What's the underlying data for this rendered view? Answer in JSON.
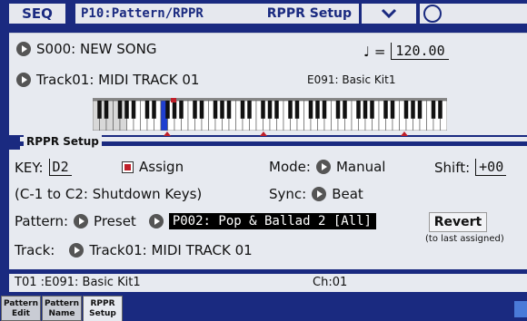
{
  "header": {
    "mode": "SEQ",
    "page": "P10:Pattern/RPPR",
    "section": "RPPR Setup"
  },
  "song": {
    "label": "S000: NEW SONG",
    "tempo_symbol": "♩ =",
    "tempo": "120.00"
  },
  "track_line": {
    "label": "Track01: MIDI TRACK 01",
    "kit": "E091: Basic Kit1"
  },
  "rppr": {
    "title": "RPPR Setup",
    "key_label": "KEY:",
    "key_value": "D2",
    "assign_label": "Assign",
    "mode_label": "Mode:",
    "mode_value": "Manual",
    "shift_label": "Shift:",
    "shift_value": "+00",
    "shutdown_note": "(C-1 to C2: Shutdown Keys)",
    "sync_label": "Sync:",
    "sync_value": "Beat",
    "pattern_label": "Pattern:",
    "pattern_source": "Preset",
    "pattern_value": "P002: Pop & Ballad 2 [All]",
    "revert_label": "Revert",
    "revert_note": "(to last assigned)",
    "track_label": "Track:",
    "track_value": "Track01: MIDI TRACK 01"
  },
  "status": {
    "track": "T01 :E091: Basic Kit1",
    "channel": "Ch:01"
  },
  "tabs": [
    {
      "line1": "Pattern",
      "line2": "Edit"
    },
    {
      "line1": "Pattern",
      "line2": "Name"
    },
    {
      "line1": "RPPR",
      "line2": "Setup"
    }
  ],
  "colors": {
    "header_bg": "#1a2a80",
    "panel_bg": "#e7eaf0",
    "checkbox": "#c0202a",
    "selected_key": "#1f3fd0",
    "marker": "#c0202a"
  }
}
